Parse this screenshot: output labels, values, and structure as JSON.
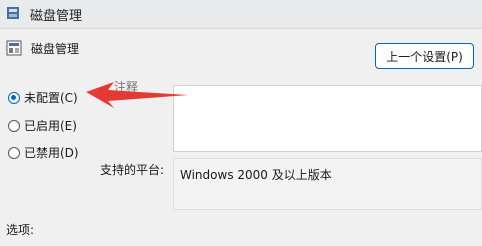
{
  "window": {
    "title": "磁盘管理"
  },
  "policy": {
    "title": "磁盘管理",
    "previous_button": "上一个设置(P)"
  },
  "state_options": [
    {
      "label": "未配置(C)",
      "checked": true
    },
    {
      "label": "已启用(E)",
      "checked": false
    },
    {
      "label": "已禁用(D)",
      "checked": false
    }
  ],
  "comment": {
    "label": "注释"
  },
  "platform": {
    "label": "支持的平台:",
    "value": "Windows 2000 及以上版本"
  },
  "options": {
    "label": "选项:"
  },
  "annotation": {
    "arrow_color": "#e53935"
  },
  "colors": {
    "accent": "#0067c0"
  }
}
